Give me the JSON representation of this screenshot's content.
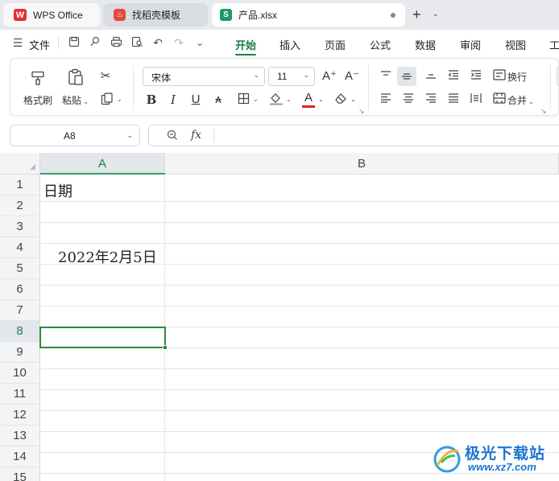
{
  "tabs": {
    "wps": {
      "icon_text": "W",
      "label": "WPS Office"
    },
    "templates": {
      "icon_text": "♨",
      "label": "找稻壳模板"
    },
    "file": {
      "icon_text": "S",
      "label": "产品.xlsx"
    },
    "add": "+",
    "more": "⌄"
  },
  "menubar": {
    "hamburger": "☰",
    "file_label": "文件",
    "more_chevron": "⌄",
    "items": [
      "开始",
      "插入",
      "页面",
      "公式",
      "数据",
      "审阅",
      "视图",
      "工"
    ],
    "active": "开始"
  },
  "ribbon": {
    "format_painter": "格式刷",
    "paste": "粘贴",
    "font_name": "宋体",
    "font_size": "11",
    "bold": "B",
    "italic": "I",
    "underline": "U",
    "strike": "ᴀ",
    "increase_font": "A⁺",
    "decrease_font": "A⁻",
    "font_color_letter": "A",
    "font_color": "#e02020",
    "wrap": "换行",
    "merge": "合并"
  },
  "formula_bar": {
    "name_box": "A8",
    "fx": "fx",
    "content": ""
  },
  "grid": {
    "columns": [
      "A",
      "B"
    ],
    "selected_column": "A",
    "rows": [
      "1",
      "2",
      "3",
      "4",
      "5",
      "6",
      "7",
      "8",
      "9",
      "10",
      "11",
      "12",
      "13",
      "14",
      "15"
    ],
    "selected_row": "8",
    "cells": {
      "A1": "日期",
      "A4": "2022年2月5日"
    }
  },
  "watermark": {
    "title": "极光下载站",
    "url": "www.xz7.com"
  },
  "colors": {
    "accent": "#1a7f49",
    "selection": "#2e8b3b"
  }
}
